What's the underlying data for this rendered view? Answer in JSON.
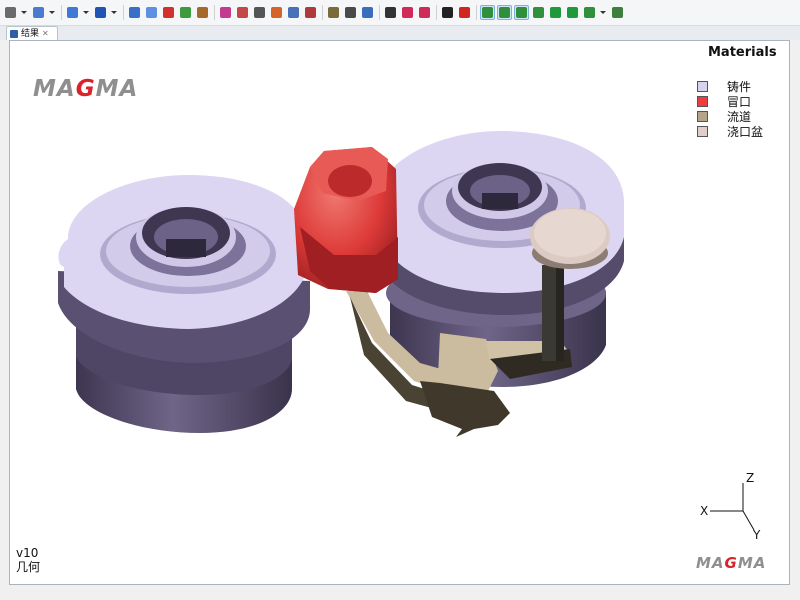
{
  "toolbar": {
    "items": [
      {
        "kind": "btn",
        "icon": "select-arrow-icon",
        "color": "#6b6b6b"
      },
      {
        "kind": "drop"
      },
      {
        "kind": "btn",
        "icon": "measure-icon",
        "color": "#4a7bd0"
      },
      {
        "kind": "drop"
      },
      {
        "kind": "sep"
      },
      {
        "kind": "btn",
        "icon": "cube-view-icon",
        "color": "#3f78d6"
      },
      {
        "kind": "drop"
      },
      {
        "kind": "btn",
        "icon": "solid-cube-icon",
        "color": "#1f55b5"
      },
      {
        "kind": "drop"
      },
      {
        "kind": "sep"
      },
      {
        "kind": "btn",
        "icon": "perspective-icon",
        "color": "#3a6fc9"
      },
      {
        "kind": "btn",
        "icon": "shaded-cube-icon",
        "color": "#5f8fe0"
      },
      {
        "kind": "btn",
        "icon": "cut-plane-icon",
        "color": "#d1302c"
      },
      {
        "kind": "btn",
        "icon": "layers-icon",
        "color": "#3d9a3d"
      },
      {
        "kind": "btn",
        "icon": "photo-icon",
        "color": "#a56a2b"
      },
      {
        "kind": "sep"
      },
      {
        "kind": "btn",
        "icon": "material-icon",
        "color": "#c33a8f"
      },
      {
        "kind": "btn",
        "icon": "mesh-icon",
        "color": "#c44747"
      },
      {
        "kind": "btn",
        "icon": "table-icon",
        "color": "#555555"
      },
      {
        "kind": "btn",
        "icon": "color-scale-icon",
        "color": "#d4642a"
      },
      {
        "kind": "btn",
        "icon": "image-icon",
        "color": "#4671b8"
      },
      {
        "kind": "btn",
        "icon": "probe-icon",
        "color": "#b03a3a"
      },
      {
        "kind": "sep"
      },
      {
        "kind": "btn",
        "icon": "camera-icon",
        "color": "#7a6a3c"
      },
      {
        "kind": "btn",
        "icon": "chart-icon",
        "color": "#4a4a4a"
      },
      {
        "kind": "btn",
        "icon": "export-icon",
        "color": "#3b6dbf"
      },
      {
        "kind": "sep"
      },
      {
        "kind": "btn",
        "icon": "box-icon",
        "color": "#333333"
      },
      {
        "kind": "btn",
        "icon": "mirror-icon",
        "color": "#d02a5a"
      },
      {
        "kind": "btn",
        "icon": "flip-icon",
        "color": "#d02a5a"
      },
      {
        "kind": "sep"
      },
      {
        "kind": "btn",
        "icon": "fill-icon",
        "color": "#222222"
      },
      {
        "kind": "btn",
        "icon": "no-entry-icon",
        "color": "#d0261f"
      },
      {
        "kind": "sep"
      },
      {
        "kind": "btn",
        "icon": "refresh-view-icon",
        "color": "#2f8f3a",
        "active": true
      },
      {
        "kind": "btn",
        "icon": "camera-view-icon",
        "color": "#2f8f3a",
        "active": true
      },
      {
        "kind": "btn",
        "icon": "grid-view-icon",
        "color": "#2f8f3a",
        "active": true
      },
      {
        "kind": "btn",
        "icon": "eye-icon",
        "color": "#2f8f3a"
      },
      {
        "kind": "btn",
        "icon": "eye-green-icon",
        "color": "#1e9a3a"
      },
      {
        "kind": "btn",
        "icon": "eye-frame-icon",
        "color": "#1e9a3a"
      },
      {
        "kind": "btn",
        "icon": "help-view-icon",
        "color": "#2f8f3a"
      },
      {
        "kind": "drop"
      },
      {
        "kind": "btn",
        "icon": "tree-icon",
        "color": "#3d7f3d"
      }
    ]
  },
  "tab": {
    "icon": "result-icon",
    "label": "结果",
    "close_icon": "close-icon",
    "close_glyph": "✕"
  },
  "viewport": {
    "legend_title": "Materials",
    "legend": [
      {
        "label": "铸件",
        "color": "#d8d2ee"
      },
      {
        "label": "冒口",
        "color": "#ec3e3e"
      },
      {
        "label": "流道",
        "color": "#b3a48a"
      },
      {
        "label": "浇口盆",
        "color": "#e1cdcb"
      }
    ],
    "logo": {
      "pre": "MA",
      "g": "G",
      "post": "MA"
    },
    "version": "v10",
    "view_mode": "几何",
    "axes": {
      "z": "Z",
      "x": "X",
      "y": "Y"
    }
  },
  "colors": {
    "casting_top": "#dcd6f2",
    "casting_side": "#5a5170",
    "riser": "#e04646",
    "runner": "#cbbca0",
    "runner_dark": "#4a4233",
    "pouring_cup": "#dccbc3",
    "logo_red": "#d9222a"
  }
}
